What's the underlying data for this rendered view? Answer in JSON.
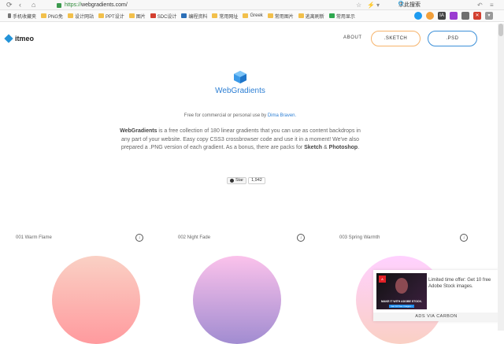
{
  "browser": {
    "url_scheme": "https://",
    "url_rest": "webgradients.com/",
    "search_text": "求此搜索",
    "bookmarks": [
      {
        "label": "手机收藏夹",
        "icon": "phone-icon"
      },
      {
        "label": "PNG免",
        "icon": "folder-icon"
      },
      {
        "label": "设计网站",
        "icon": "folder-icon"
      },
      {
        "label": "PPT设计",
        "icon": "folder-icon"
      },
      {
        "label": "图片",
        "icon": "folder-icon"
      },
      {
        "label": "SDC设计",
        "icon": "red-site-icon"
      },
      {
        "label": "编程资料",
        "icon": "blue-site-icon"
      },
      {
        "label": "常用网址",
        "icon": "folder-icon"
      },
      {
        "label": "Greek",
        "icon": "folder-icon"
      },
      {
        "label": "常用图片",
        "icon": "folder-icon"
      },
      {
        "label": "逃离刷新",
        "icon": "folder-icon"
      },
      {
        "label": "常用显示",
        "icon": "green-site-icon"
      }
    ]
  },
  "nav": {
    "logo_text": "itmeo",
    "about": "ABOUT",
    "sketch": ".SKETCH",
    "psd": ".PSD"
  },
  "hero": {
    "title": "WebGradients",
    "free_prefix": "Free for commercial or personal use by ",
    "author": "Dima Braven.",
    "desc_lead": "WebGradients",
    "desc_body": " is a free collection of 180 linear gradients that you can use as content backdrops in any part of your website. Easy copy CSS3 crossbrowser code and use it in a moment! We've also prepared a .PNG version of each gradient. As a bonus, there are packs for ",
    "desc_sketch": "Sketch",
    "desc_and": " & ",
    "desc_ps": "Photoshop",
    "desc_end": ".",
    "star_label": "Star",
    "star_count": "1,942"
  },
  "cards": [
    {
      "label": "001 Warm Flame"
    },
    {
      "label": "002 Night Fade"
    },
    {
      "label": "003 Spring Warmth"
    }
  ],
  "ad": {
    "text": "Limited time offer: Get 10 free Adobe Stock images.",
    "via": "ADS VIA CARBON",
    "caption": "MAKE IT WITH ADOBE STOCK.",
    "cta": "Get 10 free images ›",
    "brand_mark": "A"
  },
  "colors": {
    "accent": "#2d7fd4",
    "sketch_border": "#f6b36b",
    "psd_border": "#3b8fd8"
  }
}
